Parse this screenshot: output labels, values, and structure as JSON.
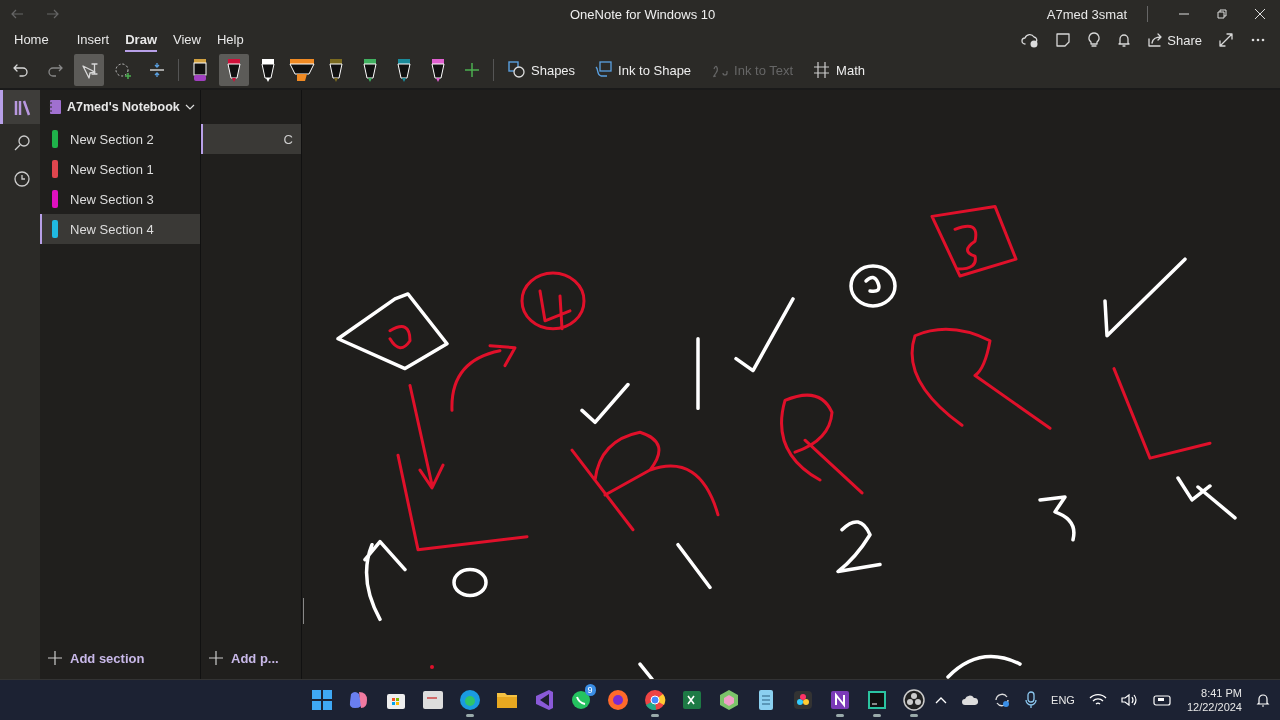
{
  "window": {
    "title": "OneNote for Windows 10",
    "user": "A7med 3smat"
  },
  "ribbon_tabs": [
    {
      "label": "Home",
      "selected": false
    },
    {
      "label": "Insert",
      "selected": false
    },
    {
      "label": "Draw",
      "selected": true
    },
    {
      "label": "View",
      "selected": false
    },
    {
      "label": "Help",
      "selected": false
    }
  ],
  "share_button": {
    "label": "Share"
  },
  "tools": [
    {
      "kind": "undo",
      "selected": false
    },
    {
      "kind": "redo",
      "selected": false
    },
    {
      "kind": "type-select",
      "selected": true
    },
    {
      "kind": "lasso",
      "selected": false
    },
    {
      "kind": "space",
      "selected": false
    }
  ],
  "pens": [
    {
      "kind": "eraser",
      "color": "#a040c0",
      "selected": false
    },
    {
      "kind": "pen",
      "color": "#d0103a",
      "selected": true
    },
    {
      "kind": "pen",
      "color": "#ffffff",
      "selected": false
    },
    {
      "kind": "highlighter",
      "color": "#f08a24",
      "selected": false
    },
    {
      "kind": "pen",
      "color": "#7a6a20",
      "selected": false
    },
    {
      "kind": "pen",
      "color": "#40b060",
      "selected": false
    },
    {
      "kind": "pen",
      "color": "#1a8a9a",
      "selected": false
    },
    {
      "kind": "pen",
      "color": "#e060d0",
      "selected": false
    }
  ],
  "actions": [
    {
      "kind": "shapes",
      "label": "Shapes",
      "disabled": false
    },
    {
      "kind": "ink-to-shape",
      "label": "Ink to Shape",
      "disabled": false
    },
    {
      "kind": "ink-to-text",
      "label": "Ink to Text",
      "disabled": true
    },
    {
      "kind": "math",
      "label": "Math",
      "disabled": false
    }
  ],
  "nav": [
    {
      "kind": "notebooks",
      "selected": true
    },
    {
      "kind": "search",
      "selected": false
    },
    {
      "kind": "recent",
      "selected": false
    }
  ],
  "notebook": {
    "title": "A7med's Notebook"
  },
  "sections": [
    {
      "name": "New Section 2",
      "color": "#1fb34a",
      "selected": false
    },
    {
      "name": "New Section 1",
      "color": "#e0464e",
      "selected": false
    },
    {
      "name": "New Section 3",
      "color": "#e010c0",
      "selected": false
    },
    {
      "name": "New Section 4",
      "color": "#20b8e0",
      "selected": true
    }
  ],
  "pages": [
    {
      "title": "C",
      "selected": true
    }
  ],
  "add_section": "Add section",
  "add_page": "Add p...",
  "taskbar": {
    "apps": [
      {
        "kind": "start",
        "running": false
      },
      {
        "kind": "copilot",
        "running": false
      },
      {
        "kind": "store",
        "running": false
      },
      {
        "kind": "whiteboard",
        "running": false
      },
      {
        "kind": "edge",
        "running": true
      },
      {
        "kind": "folder",
        "running": false
      },
      {
        "kind": "vs",
        "running": false
      },
      {
        "kind": "chat",
        "running": false,
        "badge": "9"
      },
      {
        "kind": "firefox",
        "running": false
      },
      {
        "kind": "chrome",
        "running": true
      },
      {
        "kind": "excel",
        "running": false
      },
      {
        "kind": "cube",
        "running": false
      },
      {
        "kind": "notepad",
        "running": false
      },
      {
        "kind": "resolve",
        "running": false
      },
      {
        "kind": "onenote",
        "running": true
      },
      {
        "kind": "clion",
        "running": true
      },
      {
        "kind": "obs",
        "running": true
      }
    ],
    "language": "ENG",
    "time": "8:41 PM",
    "date": "12/22/2024"
  }
}
